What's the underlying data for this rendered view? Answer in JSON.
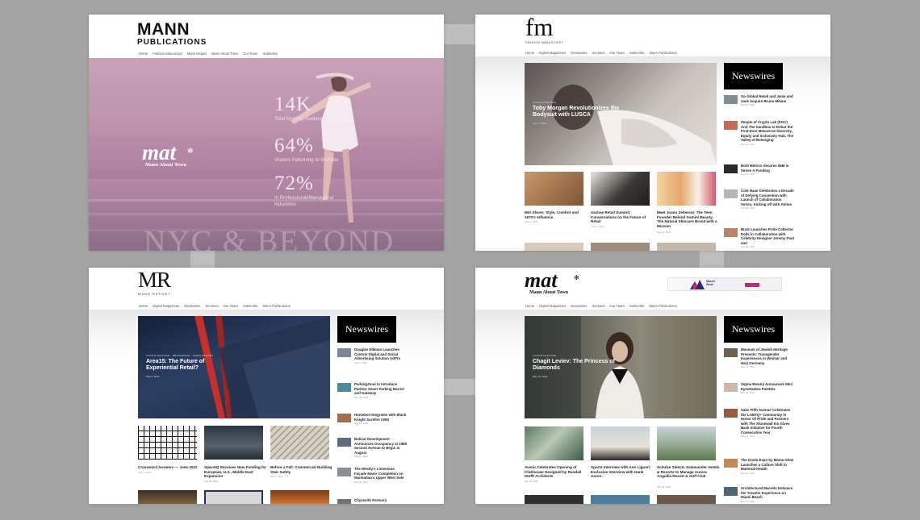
{
  "panel1": {
    "logo_top": "MANN",
    "logo_bottom": "PUBLICATIONS",
    "nav": [
      "Home",
      "Fashion Manuscript",
      "Mann Report",
      "Mann About Town",
      "Our Team",
      "Subscribe"
    ],
    "mat_logo": "mat",
    "mat_sub": "Mann About Town",
    "stats": [
      {
        "value": "14K",
        "label": "Total Monthly Audience"
      },
      {
        "value": "64%",
        "label": "Visitors Returning to Website"
      },
      {
        "value": "72%",
        "label": "In Professional/Managerial Industries"
      }
    ],
    "tagline": "NYC & BEYOND"
  },
  "panel2": {
    "logo": "fm",
    "logo_sub": "FASHION MANUSCRIPT",
    "nav": [
      "Home",
      "Digital Magazines",
      "Newswires",
      "Sections",
      "Our Team",
      "Subscribe",
      "Mann Publications"
    ],
    "hero": {
      "tag": "COVER FEATURE",
      "title": "Toby Morgan Revolutionizes the Bodysuit with LUSCA",
      "date": "June 7, 2022"
    },
    "newswires_label": "Newswires",
    "newswires": [
      {
        "title": "Go Global Retail and Janie and Jack Acquire Bruno Milano",
        "date": "May 24, 2022",
        "color": "#7d8f95"
      },
      {
        "title": "People of Crypto Lab (POC) And The Sandbox to Debut the First-Ever Metaverse Diversity, Equity and Inclusivity Hub, The Valley of Belonging",
        "date": "May 24, 2022",
        "color": "#c86a5a"
      },
      {
        "title": "Bold Metrics Secures $6M in Series A Funding",
        "date": "May 24, 2022",
        "color": "#2a2a2a"
      },
      {
        "title": "Cole Haan Celebrates a Decade of Defying Convention with Launch of Collaboration Series, Kicking off with Atmos",
        "date": "May 24, 2022",
        "color": "#b4b8b0"
      },
      {
        "title": "Bratz Launches Pride Collector Dolls in Collaboration with Celebrity Designer Jeremy Paul and",
        "date": "May 24, 2022",
        "color": "#b98562"
      }
    ],
    "cards": [
      {
        "title": "MIA Shoes: Style, Comfort and 1970's Influence",
        "date": "June 1, 2022",
        "color": "#a87e55"
      },
      {
        "title": "Sachse Retail Summit: Conversations on the Future of Retail",
        "date": "June 2, 2022",
        "color": "#3c3a38"
      },
      {
        "title": "Meet Joann Zeheroni: The Teen Founder Behind Gemini Beauty, The Natural Skincare Brand with a Mission",
        "date": "May 31, 2022",
        "color": "#e2c39a"
      }
    ]
  },
  "panel3": {
    "logo": "MR",
    "logo_sub": "MANN REPORT",
    "nav": [
      "Home",
      "Digital Magazines",
      "Newswires",
      "Sections",
      "Our Team",
      "Subscribe",
      "Mann Publications"
    ],
    "hero": {
      "tag": "COVER FEATURE · BROKERAGE · MANN REPORT",
      "title": "Area15: The Future of Experiential Retail?",
      "date": "May 9, 2022"
    },
    "newswires_label": "Newswires",
    "newswires": [
      {
        "title": "Douglas Elliman Launches Custom Digital and Social Advertising Solution AdPro",
        "date": "June 7, 2022",
        "color": "#7b8894"
      },
      {
        "title": "ParkingZone to Introduce ParkGo Smart Parking Barrier and Gateway",
        "date": "May 24, 2022",
        "color": "#4d8aa0"
      },
      {
        "title": "Homebot Integrates with Black Knight Surefire CRM",
        "date": "May 24, 2022",
        "color": "#a66f4c"
      },
      {
        "title": "Bolivar Development Announces Occupancy at 1998 Second Avenue to Begin in August",
        "date": "May 24, 2022",
        "color": "#5c6b7d"
      },
      {
        "title": "The Westly's Limestone Façade Nears Completion on Manhattan's Upper West Side",
        "date": "May 24, 2022",
        "color": "#8a8f93"
      },
      {
        "title": "Cityzenith Partners",
        "date": "",
        "color": "#6d7479"
      }
    ],
    "cards": [
      {
        "title": "Crossword Answers — June 2022",
        "date": "June 1, 2022",
        "color": "#e8e8e8"
      },
      {
        "title": "SpaceIQ Receives New Funding for European, U.S., Middle East Expansion",
        "date": "May 26, 2022",
        "color": "#3d4a53"
      },
      {
        "title": "Before a Fall: Commercial Building Stair Safety",
        "date": "May 9, 2022",
        "color": "#c9c0b3"
      }
    ]
  },
  "panel4": {
    "logo": "mat",
    "logo_sub": "Mann About Town",
    "ad_brand": "Mount Sinai",
    "nav": [
      "Home",
      "Digital Magazines",
      "Newswires",
      "Sections",
      "Our Team",
      "Subscribe",
      "Mann Publications"
    ],
    "hero": {
      "tag": "COVER FEATURE",
      "title": "Chagit Leviev: The Princess of Diamonds",
      "date": "May 24, 2022"
    },
    "newswires_label": "Newswires",
    "newswires": [
      {
        "title": "Museum of Jewish Heritage Presents: Transgender Experiences in Weimar and Nazi Germany",
        "date": "May 24, 2022",
        "color": "#6d6052"
      },
      {
        "title": "Sigma Beauty Announces Mini EyesHadow Palettes",
        "date": "May 24, 2022",
        "color": "#d2b7a5"
      },
      {
        "title": "Saks Fifth Avenue Celebrates the LGBTQ+ Community in Honor Of Pride and Partners with The Stonewall Inn Gives Back Initiative for Fourth Consecutive Year",
        "date": "May 24, 2022",
        "color": "#9a5a3c"
      },
      {
        "title": "The Doula Expo by Mama Glow Launches a Culture Shift in Maternal Health",
        "date": "May 24, 2022",
        "color": "#c58a4e"
      },
      {
        "title": "Architectural Marvels Enhance the Traveler Experience on Miami Beach",
        "date": "May 24, 2022",
        "color": "#4d6676"
      }
    ],
    "cards": [
      {
        "title": "Avenir Celebrates Opening of Clubhouse Designed by Randall Stofft Architects",
        "date": "May 26, 2022",
        "color": "#6b8a66"
      },
      {
        "title": "Sports Interview with Ann Liguori: Exclusive Interview with Hank Aaron",
        "date": "May 26, 2022",
        "color": "#b7c4cc"
      },
      {
        "title": "Schulze Selects Salamander Hotels & Resorts to Manage Aurora Anguilla Resort & Golf Club",
        "date": "May 26, 2022",
        "color": "#7a8e6a"
      }
    ]
  }
}
